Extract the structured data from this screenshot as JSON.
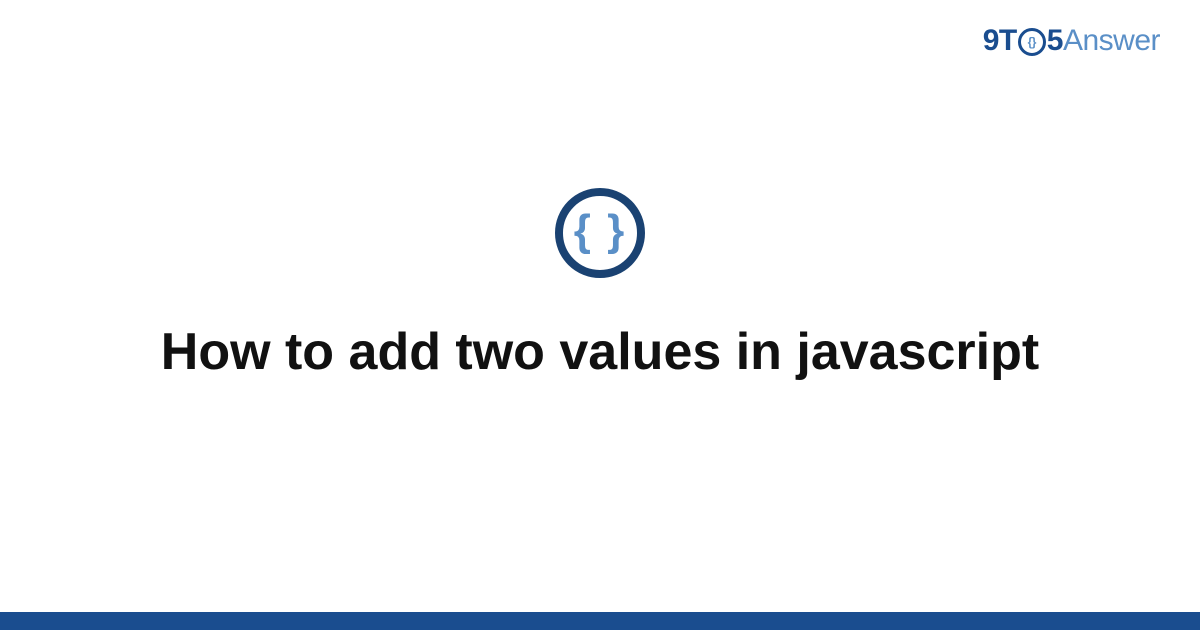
{
  "brand": {
    "part1": "9T",
    "ring_inner": "{}",
    "part2": "5",
    "part3": "Answer"
  },
  "badge": {
    "symbol": "{ }"
  },
  "heading": "How to add two values in javascript",
  "colors": {
    "brand_dark": "#1a4d8f",
    "brand_light": "#5a8fc7",
    "icon_ring": "#1a4272",
    "text": "#111111"
  }
}
